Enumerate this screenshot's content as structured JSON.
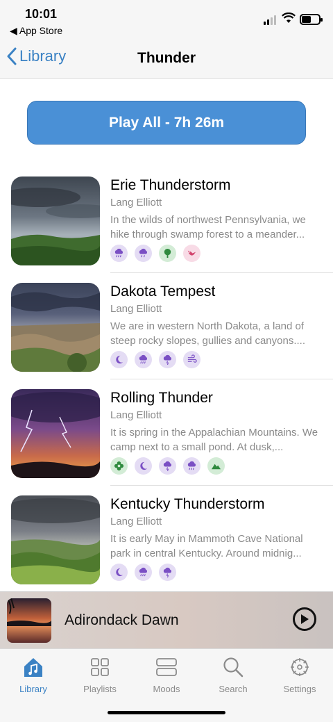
{
  "status_bar": {
    "time": "10:01",
    "back_app": "◀ App Store"
  },
  "nav": {
    "back_label": "Library",
    "title": "Thunder"
  },
  "play_all": {
    "label": "Play All - 7h 26m"
  },
  "tracks": [
    {
      "title": "Erie Thunderstorm",
      "artist": "Lang Elliott",
      "description": "In the wilds of northwest Pennsylvania, we hike through swamp forest to a meander...",
      "tags": [
        {
          "icon": "rain-cloud-icon",
          "color": "purple"
        },
        {
          "icon": "rain-cloud-icon",
          "color": "purple"
        },
        {
          "icon": "tree-icon",
          "color": "green"
        },
        {
          "icon": "bird-icon",
          "color": "pink"
        }
      ]
    },
    {
      "title": "Dakota Tempest",
      "artist": "Lang Elliott",
      "description": "We are in western North Dakota, a land of steep rocky slopes, gullies and canyons....",
      "tags": [
        {
          "icon": "moon-icon",
          "color": "purple"
        },
        {
          "icon": "rain-cloud-icon",
          "color": "purple"
        },
        {
          "icon": "thunder-cloud-icon",
          "color": "purple"
        },
        {
          "icon": "wind-icon",
          "color": "purple"
        }
      ]
    },
    {
      "title": "Rolling Thunder",
      "artist": "Lang Elliott",
      "description": "It is spring in the Appalachian Mountains. We camp next to a small pond. At dusk,...",
      "tags": [
        {
          "icon": "flower-icon",
          "color": "green"
        },
        {
          "icon": "moon-icon",
          "color": "purple"
        },
        {
          "icon": "thunder-cloud-icon",
          "color": "purple"
        },
        {
          "icon": "rain-cloud-icon",
          "color": "purple"
        },
        {
          "icon": "mountain-icon",
          "color": "green"
        }
      ]
    },
    {
      "title": "Kentucky Thunderstorm",
      "artist": "Lang Elliott",
      "description": "It is early May in Mammoth Cave National park in central Kentucky. Around midnig...",
      "tags": [
        {
          "icon": "moon-icon",
          "color": "purple"
        },
        {
          "icon": "rain-cloud-icon",
          "color": "purple"
        },
        {
          "icon": "thunder-cloud-icon",
          "color": "purple"
        }
      ]
    }
  ],
  "now_playing": {
    "title": "Adirondack Dawn"
  },
  "tabs": [
    {
      "label": "Library",
      "icon": "house-music-icon",
      "active": true
    },
    {
      "label": "Playlists",
      "icon": "grid-icon",
      "active": false
    },
    {
      "label": "Moods",
      "icon": "stacked-boxes-icon",
      "active": false
    },
    {
      "label": "Search",
      "icon": "search-icon",
      "active": false
    },
    {
      "label": "Settings",
      "icon": "gear-icon",
      "active": false
    }
  ],
  "colors": {
    "accent": "#3b82c4",
    "play_all_bg": "#4a90d6",
    "tag_purple_bg": "#e4dcf4",
    "tag_purple_fg": "#7a4fc4",
    "tag_green_bg": "#d3ecd6",
    "tag_green_fg": "#2f8a3e",
    "tag_pink_bg": "#f8dbe6",
    "tag_pink_fg": "#d2456e"
  }
}
